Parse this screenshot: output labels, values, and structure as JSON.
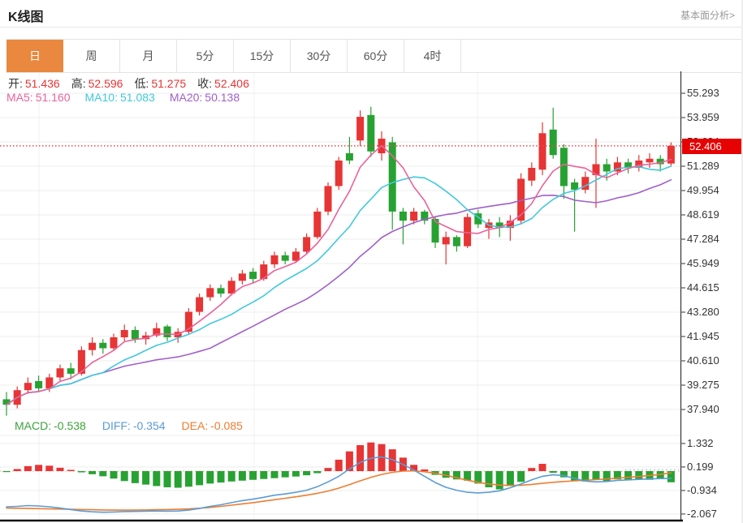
{
  "header": {
    "title": "K线图",
    "link_label": "基本面分析>"
  },
  "tabs": {
    "active": "日",
    "items": [
      "日",
      "周",
      "月",
      "5分",
      "15分",
      "30分",
      "60分",
      "4时"
    ]
  },
  "ohlc_legend": [
    {
      "label": "开:",
      "value": "51.436"
    },
    {
      "label": "高:",
      "value": "52.596"
    },
    {
      "label": "低:",
      "value": "51.275"
    },
    {
      "label": "收:",
      "value": "52.406"
    }
  ],
  "ma_legend": [
    {
      "label": "MA5:",
      "value": "51.160",
      "color": "#e8639b"
    },
    {
      "label": "MA10:",
      "value": "51.083",
      "color": "#41c8dc"
    },
    {
      "label": "MA20:",
      "value": "50.138",
      "color": "#a05fc9"
    }
  ],
  "macd_legend": [
    {
      "label": "MACD:",
      "value": "-0.538",
      "color": "#3da23d"
    },
    {
      "label": "DIFF:",
      "value": "-0.354",
      "color": "#5b9bd5"
    },
    {
      "label": "DEA:",
      "value": "-0.085",
      "color": "#ed7d31"
    }
  ],
  "current_price_label": "52.406",
  "colors": {
    "up": "#e73434",
    "down": "#27a232",
    "ma5": "#e8639b",
    "ma10": "#41c8dc",
    "ma20": "#a05fc9",
    "diff": "#5b9bd5",
    "dea": "#ed7d31",
    "badge": "#e60202",
    "accent_tab": "#e9883e",
    "dotted_price_line": "#ee4747",
    "grid": "#ededed",
    "axis": "#333333"
  },
  "chart_data": {
    "type": "candlestick",
    "title": "K线图",
    "interval": "日",
    "current_price": 52.406,
    "y_axis": {
      "ticks": [
        55.293,
        53.959,
        52.624,
        51.289,
        49.954,
        48.619,
        47.284,
        45.949,
        44.615,
        43.28,
        41.945,
        40.61,
        39.275,
        37.94
      ],
      "grid": true
    },
    "candles_ohlc": [
      [
        38.5,
        38.9,
        37.6,
        38.2
      ],
      [
        38.2,
        39.2,
        38.0,
        39.0
      ],
      [
        39.0,
        39.7,
        38.8,
        39.4
      ],
      [
        39.5,
        39.8,
        38.9,
        39.1
      ],
      [
        39.1,
        39.9,
        38.9,
        39.7
      ],
      [
        39.7,
        40.4,
        39.5,
        40.2
      ],
      [
        40.2,
        40.5,
        39.6,
        39.9
      ],
      [
        39.9,
        41.4,
        39.8,
        41.2
      ],
      [
        41.2,
        41.9,
        40.9,
        41.6
      ],
      [
        41.6,
        41.8,
        41.0,
        41.3
      ],
      [
        41.3,
        42.1,
        41.2,
        41.9
      ],
      [
        41.9,
        42.6,
        41.7,
        42.3
      ],
      [
        42.3,
        42.5,
        41.6,
        41.8
      ],
      [
        41.8,
        42.2,
        41.5,
        42.0
      ],
      [
        42.0,
        42.7,
        41.9,
        42.4
      ],
      [
        42.5,
        42.6,
        41.7,
        41.9
      ],
      [
        41.9,
        42.4,
        41.6,
        42.2
      ],
      [
        42.2,
        43.5,
        42.1,
        43.3
      ],
      [
        43.3,
        44.3,
        43.1,
        44.1
      ],
      [
        44.1,
        44.8,
        43.9,
        44.6
      ],
      [
        44.6,
        44.8,
        44.1,
        44.3
      ],
      [
        44.3,
        45.2,
        44.2,
        45.0
      ],
      [
        45.0,
        45.6,
        44.8,
        45.4
      ],
      [
        45.5,
        45.7,
        44.9,
        45.1
      ],
      [
        45.1,
        46.1,
        45.0,
        45.9
      ],
      [
        45.9,
        46.6,
        45.7,
        46.4
      ],
      [
        46.4,
        46.6,
        45.9,
        46.1
      ],
      [
        46.1,
        46.8,
        46.0,
        46.6
      ],
      [
        46.6,
        47.6,
        46.5,
        47.4
      ],
      [
        47.4,
        49.0,
        47.3,
        48.8
      ],
      [
        48.8,
        50.4,
        48.6,
        50.2
      ],
      [
        50.2,
        51.8,
        50.0,
        51.6
      ],
      [
        52.0,
        52.9,
        51.4,
        51.6
      ],
      [
        52.7,
        54.35,
        52.4,
        54.0
      ],
      [
        54.1,
        54.55,
        51.8,
        52.1
      ],
      [
        52.0,
        53.2,
        51.6,
        52.8
      ],
      [
        52.6,
        52.9,
        47.8,
        48.8
      ],
      [
        48.8,
        49.0,
        47.0,
        48.3
      ],
      [
        48.3,
        49.0,
        48.1,
        48.8
      ],
      [
        48.8,
        48.9,
        48.1,
        48.3
      ],
      [
        48.4,
        48.5,
        46.8,
        47.1
      ],
      [
        47.0,
        47.7,
        45.9,
        47.4
      ],
      [
        47.4,
        47.5,
        46.6,
        46.9
      ],
      [
        46.9,
        48.7,
        46.8,
        48.5
      ],
      [
        48.7,
        48.9,
        47.9,
        48.1
      ],
      [
        47.9,
        48.4,
        47.3,
        48.2
      ],
      [
        48.2,
        48.5,
        47.4,
        47.9
      ],
      [
        47.9,
        48.6,
        47.2,
        48.3
      ],
      [
        48.3,
        50.9,
        48.1,
        50.6
      ],
      [
        50.5,
        51.5,
        50.2,
        51.2
      ],
      [
        51.1,
        53.7,
        50.8,
        53.1
      ],
      [
        53.3,
        54.5,
        51.7,
        51.9
      ],
      [
        52.3,
        52.5,
        49.5,
        50.2
      ],
      [
        50.4,
        50.6,
        47.7,
        50.0
      ],
      [
        50.0,
        51.0,
        49.8,
        50.7
      ],
      [
        50.8,
        52.8,
        49.0,
        51.4
      ],
      [
        51.4,
        51.7,
        50.5,
        51.0
      ],
      [
        51.0,
        51.8,
        50.8,
        51.5
      ],
      [
        51.5,
        51.7,
        50.9,
        51.2
      ],
      [
        51.2,
        51.9,
        51.0,
        51.6
      ],
      [
        51.5,
        52.0,
        51.2,
        51.7
      ],
      [
        51.7,
        51.9,
        51.0,
        51.4
      ],
      [
        51.436,
        52.596,
        51.275,
        52.406
      ]
    ],
    "moving_averages": {
      "periods": [
        5,
        10,
        20
      ],
      "MA5": 51.16,
      "MA10": 51.083,
      "MA20": 50.138
    },
    "macd": {
      "ticks": [
        1.332,
        0.199,
        -0.934,
        -2.067
      ],
      "latest": {
        "MACD": -0.538,
        "DIFF": -0.354,
        "DEA": -0.085
      },
      "hist": [
        -0.04,
        0.1,
        0.24,
        0.3,
        0.26,
        0.16,
        0.06,
        -0.06,
        -0.15,
        -0.25,
        -0.36,
        -0.48,
        -0.58,
        -0.65,
        -0.72,
        -0.78,
        -0.8,
        -0.75,
        -0.68,
        -0.6,
        -0.55,
        -0.5,
        -0.46,
        -0.42,
        -0.38,
        -0.34,
        -0.3,
        -0.26,
        -0.2,
        -0.1,
        0.15,
        0.55,
        0.95,
        1.25,
        1.38,
        1.3,
        1.05,
        0.65,
        0.3,
        0.08,
        -0.18,
        -0.32,
        -0.4,
        -0.46,
        -0.6,
        -0.78,
        -0.88,
        -0.72,
        -0.52,
        0.15,
        0.35,
        -0.08,
        -0.3,
        -0.45,
        -0.5,
        -0.42,
        -0.48,
        -0.4,
        -0.45,
        -0.38,
        -0.42,
        -0.35,
        -0.538
      ],
      "diff": [
        -1.72,
        -1.7,
        -1.66,
        -1.68,
        -1.72,
        -1.78,
        -1.85,
        -1.92,
        -1.96,
        -1.98,
        -1.97,
        -1.95,
        -1.94,
        -1.93,
        -1.92,
        -1.93,
        -1.92,
        -1.88,
        -1.8,
        -1.7,
        -1.62,
        -1.52,
        -1.42,
        -1.35,
        -1.26,
        -1.16,
        -1.1,
        -1.02,
        -0.92,
        -0.75,
        -0.52,
        -0.25,
        0.1,
        0.42,
        0.62,
        0.68,
        0.55,
        0.32,
        0.05,
        -0.25,
        -0.55,
        -0.78,
        -0.92,
        -1.02,
        -1.05,
        -1.02,
        -0.95,
        -0.8,
        -0.62,
        -0.42,
        -0.25,
        -0.18,
        -0.22,
        -0.35,
        -0.48,
        -0.52,
        -0.5,
        -0.45,
        -0.42,
        -0.4,
        -0.38,
        -0.36,
        -0.354
      ],
      "dea": [
        -1.78,
        -1.79,
        -1.8,
        -1.81,
        -1.82,
        -1.83,
        -1.84,
        -1.85,
        -1.86,
        -1.87,
        -1.88,
        -1.88,
        -1.88,
        -1.87,
        -1.86,
        -1.85,
        -1.84,
        -1.82,
        -1.79,
        -1.75,
        -1.7,
        -1.64,
        -1.58,
        -1.52,
        -1.45,
        -1.38,
        -1.31,
        -1.24,
        -1.16,
        -1.07,
        -0.96,
        -0.82,
        -0.65,
        -0.47,
        -0.3,
        -0.16,
        -0.06,
        0.0,
        0.01,
        -0.03,
        -0.1,
        -0.2,
        -0.32,
        -0.44,
        -0.54,
        -0.62,
        -0.67,
        -0.69,
        -0.68,
        -0.64,
        -0.59,
        -0.54,
        -0.5,
        -0.47,
        -0.44,
        -0.41,
        -0.38,
        -0.34,
        -0.3,
        -0.26,
        -0.21,
        -0.16,
        -0.085
      ]
    }
  }
}
